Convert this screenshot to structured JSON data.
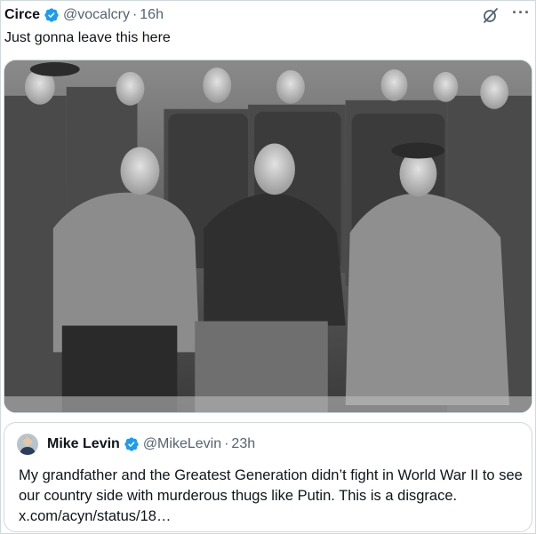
{
  "post": {
    "display_name": "Circe",
    "handle": "@vocalcry",
    "separator": "·",
    "time": "16h",
    "text": "Just gonna leave this here",
    "more_label": "···"
  },
  "quoted": {
    "display_name": "Mike Levin",
    "handle": "@MikeLevin",
    "separator": "·",
    "time": "23h",
    "text": "My grandfather and the Greatest Generation didn’t fight in World War II to see our country side with murderous thugs like Putin. This is a disgrace. x.com/acyn/status/18…"
  },
  "colors": {
    "verified": "#1d9bf0",
    "secondary_text": "#536471",
    "border": "#cfd9de"
  },
  "icons": {
    "verified": "verified-badge-icon",
    "grok": "grok-icon",
    "more": "more-options-icon"
  }
}
